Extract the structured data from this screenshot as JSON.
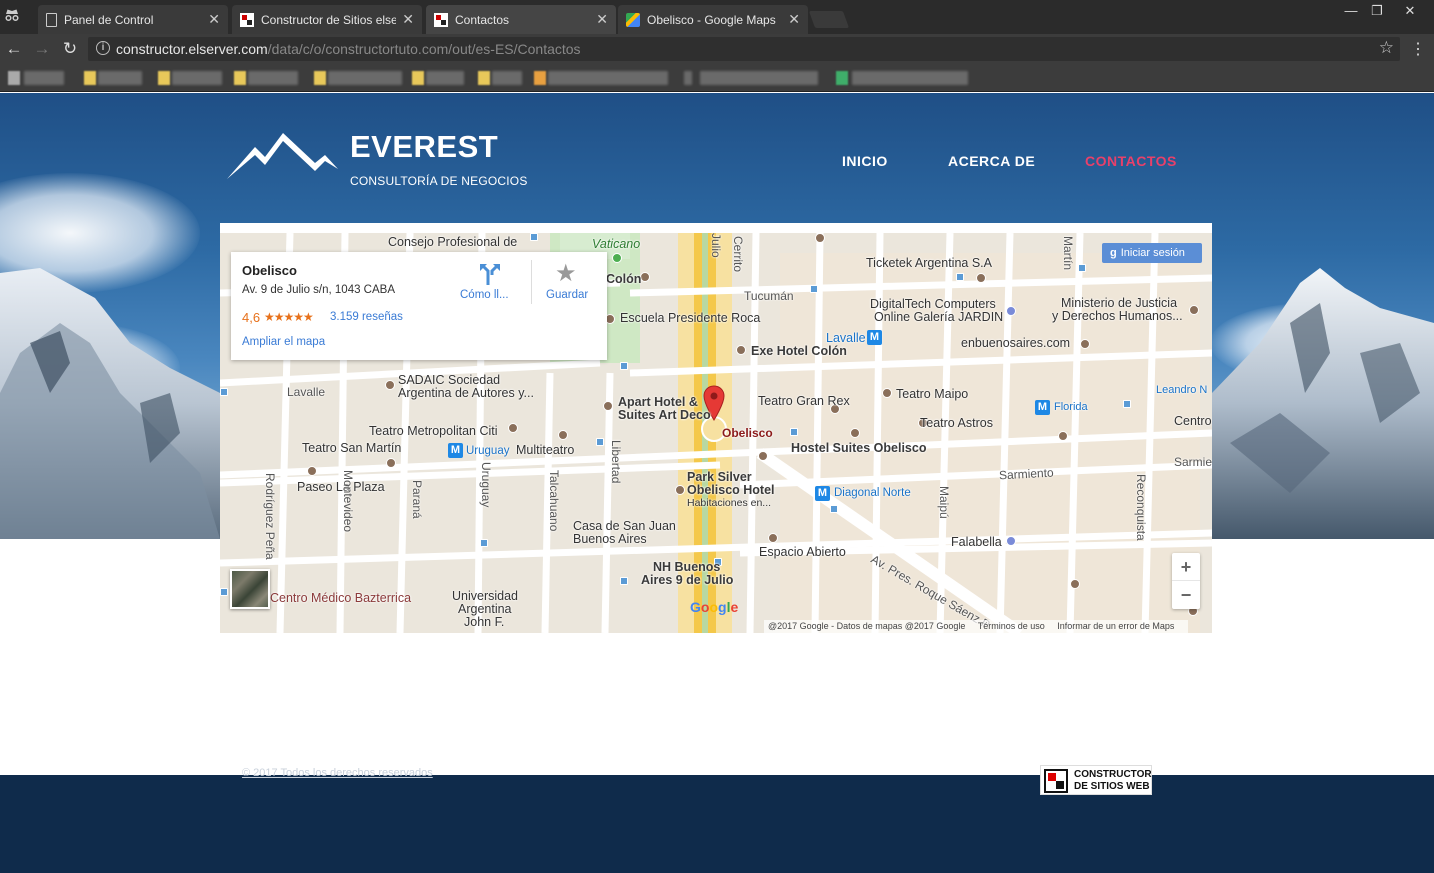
{
  "browser": {
    "tabs": [
      {
        "title": "Panel de Control",
        "icon": "page-icon",
        "active": false
      },
      {
        "title": "Constructor de Sitios elserv",
        "icon": "constructor-icon",
        "active": false
      },
      {
        "title": "Contactos",
        "icon": "constructor-icon",
        "active": true
      },
      {
        "title": "Obelisco - Google Maps",
        "icon": "google-maps-icon",
        "active": false
      }
    ],
    "url_host": "constructor.elserver.com",
    "url_path": "/data/c/o/constructortuto.com/out/es-ES/Contactos"
  },
  "site": {
    "brand": "EVEREST",
    "tagline": "CONSULTORÍA DE NEGOCIOS",
    "nav": [
      {
        "label": "INICIO",
        "active": false
      },
      {
        "label": "ACERCA DE",
        "active": false
      },
      {
        "label": "CONTACTOS",
        "active": true
      }
    ],
    "accent_color": "#e8406a"
  },
  "map": {
    "place_card": {
      "name": "Obelisco",
      "address": "Av. 9 de Julio s/n, 1043 CABA",
      "rating": "4,6",
      "stars": "★★★★★",
      "reviews": "3.159 reseñas",
      "expand": "Ampliar el mapa",
      "directions": "Cómo ll...",
      "save": "Guardar"
    },
    "signin": "Iniciar sesión",
    "zoom_in": "+",
    "zoom_out": "−",
    "google": "Google",
    "attribution": [
      "@2017 Google - Datos de mapas @2017 Google",
      "Términos de uso",
      "Informar de un error de Maps"
    ],
    "labels": [
      "Consejo Profesional de",
      "Vaticano",
      "Colón",
      "Tucumán",
      "Ticketek Argentina S.A",
      "DigitalTech Computers",
      "Online Galería JARDIN",
      "Ministerio de Justicia",
      "y Derechos Humanos...",
      "Escuela Presidente Roca",
      "Lavalle",
      "enbuenosaires.com",
      "Exe Hotel Colón",
      "SADAIC Sociedad",
      "Argentina de Autores y...",
      "Lavalle",
      "Apart Hotel &",
      "Suites Art Deco",
      "Teatro Gran Rex",
      "Teatro Maipo",
      "Leandro N",
      "Florida",
      "Teatro Metropolitan Citi",
      "Obelisco",
      "Teatro Astros",
      "Centro",
      "Teatro San Martín",
      "Uruguay",
      "Multiteatro",
      "Hostel Suites Obelisco",
      "Sarmiento",
      "Sarmie",
      "Paseo La Plaza",
      "Park Silver",
      "Obelisco Hotel",
      "Habitaciones en...",
      "Diagonal Norte",
      "Casa de San Juan",
      "Buenos Aires",
      "Falabella",
      "Espacio Abierto",
      "NH Buenos",
      "Aires 9 de Julio",
      "Av. Pres. Roque Sáenz P",
      "Universidad",
      "Argentina",
      "John F.",
      "Centro Médico Bazterrica",
      "Rodríguez Peña",
      "Montevideo",
      "Paraná",
      "Uruguay",
      "Talcahuano",
      "Libertad",
      "Maipú",
      "Reconquista",
      "Martín",
      "Julio",
      "Cerrito"
    ]
  },
  "footer": {
    "copyright": "© 2017  Todos los derechos reservados",
    "badge_line1": "CONSTRUCTOR",
    "badge_line2": "DE SITIOS WEB"
  }
}
